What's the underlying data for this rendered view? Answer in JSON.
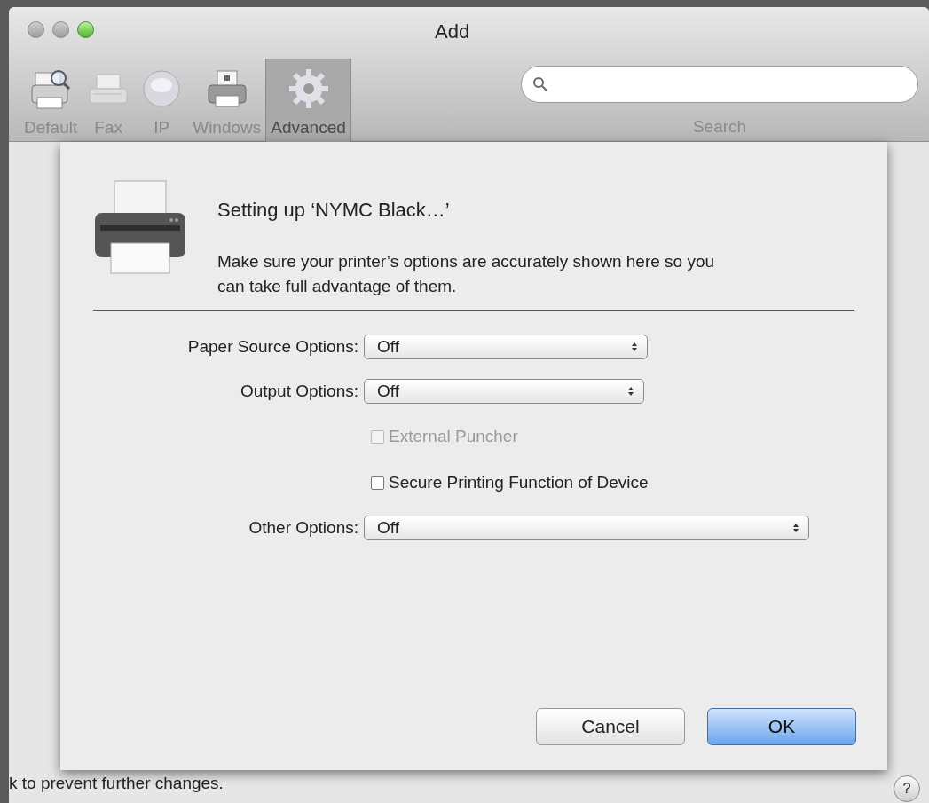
{
  "window": {
    "title": "Add"
  },
  "toolbar": {
    "items": [
      {
        "kind": "printer-magnifier",
        "label": "Default",
        "selected": false
      },
      {
        "kind": "fax",
        "label": "Fax",
        "selected": false
      },
      {
        "kind": "globe",
        "label": "IP",
        "selected": false
      },
      {
        "kind": "printer",
        "label": "Windows",
        "selected": false
      },
      {
        "kind": "gear",
        "label": "Advanced",
        "selected": true
      }
    ],
    "search_label": "Search"
  },
  "sheet": {
    "title": "Setting up ‘NYMC Black…’",
    "message": "Make sure your printer’s options are accurately shown here so you can take full advantage of them.",
    "options": [
      {
        "kind": "popup",
        "label": "Paper Source Options:",
        "value": "Off"
      },
      {
        "kind": "popup",
        "label": "Output Options:",
        "value": "Off"
      },
      {
        "kind": "checkbox",
        "label": "External Puncher",
        "checked": false,
        "disabled": true
      },
      {
        "kind": "checkbox",
        "label": "Secure Printing Function of Device",
        "checked": false,
        "disabled": false
      },
      {
        "kind": "popup",
        "label": "Other Options:",
        "value": "Off"
      }
    ],
    "buttons": [
      {
        "label": "Cancel",
        "default": false
      },
      {
        "label": "OK",
        "default": true
      }
    ]
  },
  "status_text": "k to prevent further changes.",
  "help_button": "?"
}
